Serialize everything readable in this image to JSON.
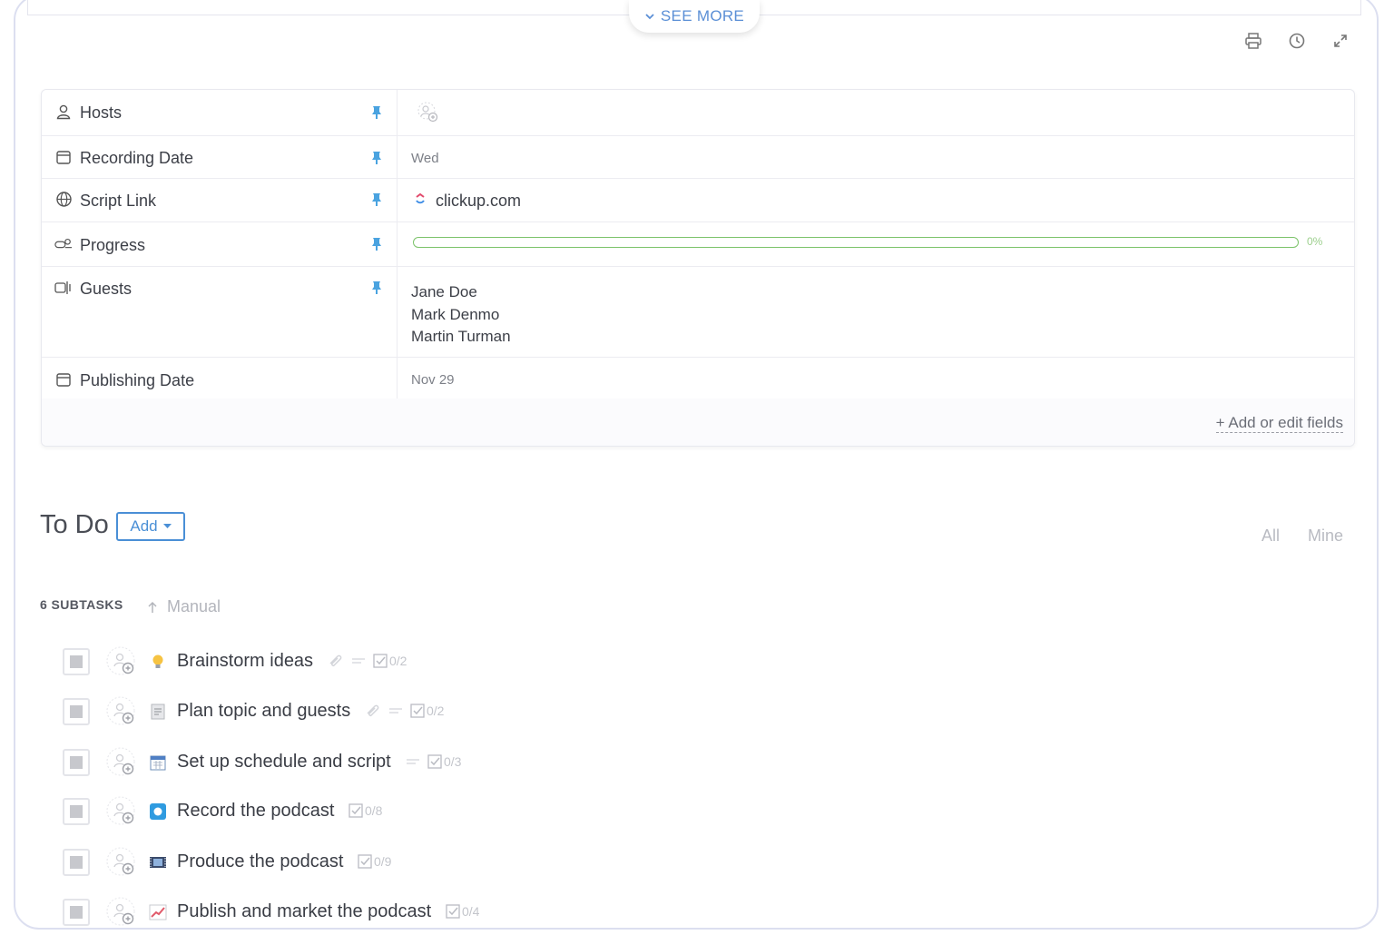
{
  "header": {
    "see_more": "SEE MORE",
    "tools": [
      "printer-icon",
      "history-icon",
      "expand-icon"
    ]
  },
  "fields": [
    {
      "label": "Hosts",
      "icon": "user-icon",
      "value": ""
    },
    {
      "label": "Recording Date",
      "icon": "calendar-icon",
      "value": "Wed"
    },
    {
      "label": "Script Link",
      "icon": "globe-icon",
      "value": "clickup.com"
    },
    {
      "label": "Progress",
      "icon": "progress-icon",
      "value": "0%",
      "progress": 0
    },
    {
      "label": "Guests",
      "icon": "people-icon",
      "value": [
        "Jane Doe",
        "Mark Denmo",
        "Martin Turman"
      ]
    },
    {
      "label": "Publishing Date",
      "icon": "calendar-icon",
      "value": "Nov 29"
    }
  ],
  "add_fields": "+ Add or edit fields",
  "todo": {
    "title": "To Do",
    "add_label": "Add",
    "filters": [
      "All",
      "Mine"
    ],
    "subtask_count": "6 SUBTASKS",
    "sort": "Manual"
  },
  "colors": {
    "accent": "#4a8fd6",
    "progress": "#7cc36a",
    "pin": "#4aa3e0"
  },
  "tasks": [
    {
      "name": "Brainstorm ideas",
      "emoji": "lightbulb",
      "checklist": "0/2",
      "has_attach": true,
      "has_desc": true
    },
    {
      "name": "Plan topic and guests",
      "emoji": "memo",
      "checklist": "0/2",
      "has_attach": true,
      "has_desc": true
    },
    {
      "name": "Set up schedule and script",
      "emoji": "calendar",
      "checklist": "0/3",
      "has_attach": false,
      "has_desc": true
    },
    {
      "name": "Record the podcast",
      "emoji": "record",
      "checklist": "0/8",
      "has_attach": false,
      "has_desc": false
    },
    {
      "name": "Produce the podcast",
      "emoji": "film",
      "checklist": "0/9",
      "has_attach": false,
      "has_desc": false
    },
    {
      "name": "Publish and market the podcast",
      "emoji": "chart",
      "checklist": "0/4",
      "has_attach": false,
      "has_desc": false
    }
  ]
}
